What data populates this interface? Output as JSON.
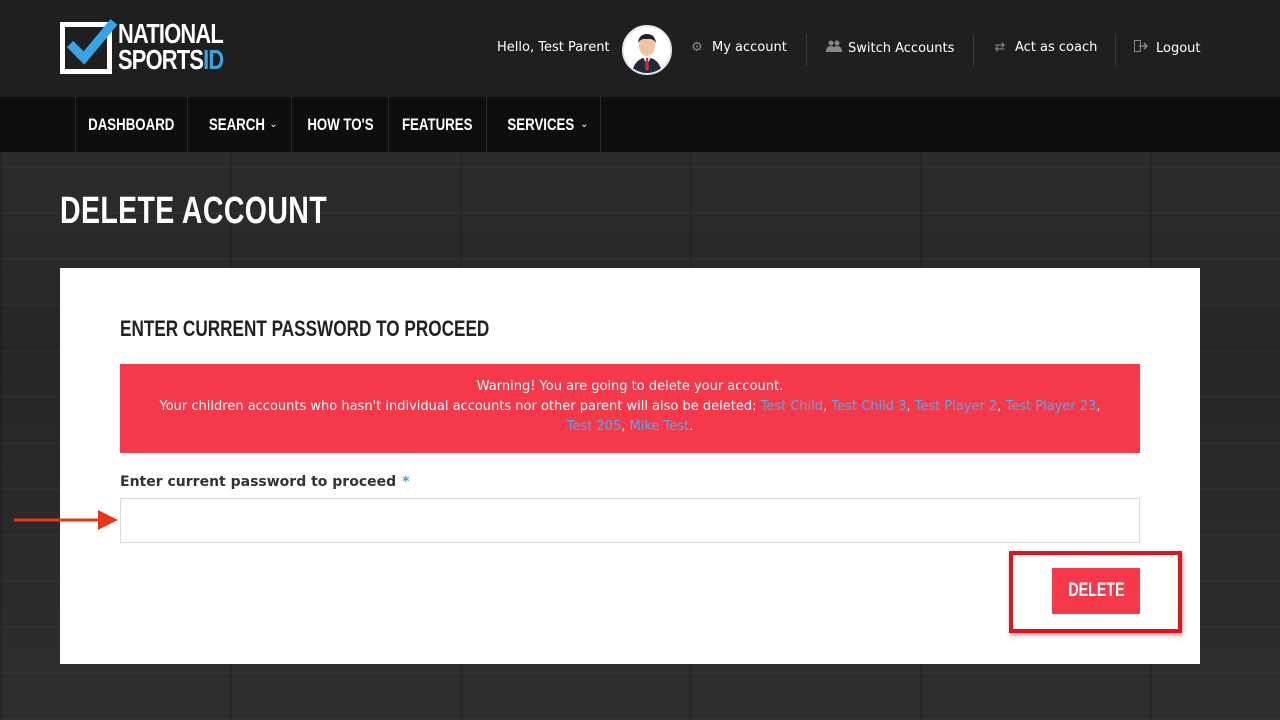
{
  "brand": {
    "line1": "NATIONAL",
    "line2": "SPORTS",
    "suffix": "ID",
    "accent_color": "#3aa3e3"
  },
  "header": {
    "greeting": "Hello, Test Parent",
    "avatar_icon": "user-avatar",
    "links": [
      {
        "label": "My account",
        "icon": "gear-icon"
      },
      {
        "label": "Switch Accounts",
        "icon": "users-icon"
      },
      {
        "label": "Act as coach",
        "icon": "exchange-icon"
      },
      {
        "label": "Logout",
        "icon": "logout-icon"
      }
    ]
  },
  "nav": {
    "items": [
      {
        "label": "DASHBOARD",
        "dropdown": false
      },
      {
        "label": "SEARCH",
        "dropdown": true
      },
      {
        "label": "HOW TO'S",
        "dropdown": false
      },
      {
        "label": "FEATURES",
        "dropdown": false
      },
      {
        "label": "SERVICES",
        "dropdown": true
      }
    ]
  },
  "page": {
    "title": "DELETE ACCOUNT"
  },
  "form": {
    "heading": "ENTER CURRENT PASSWORD TO PROCEED",
    "warning": {
      "line1": "Warning! You are going to delete your account.",
      "line2_prefix": "Your children accounts who hasn't individual accounts nor other parent will also be deleted: ",
      "children": [
        "Test Child",
        "Test Child 3",
        "Test Player 2",
        "Test Player 23",
        "Test 205",
        "Mike Test"
      ],
      "separator": ", ",
      "suffix": ".",
      "background": "#f5384a"
    },
    "password_label": "Enter current password to proceed",
    "required_mark": "*",
    "password_value": "",
    "delete_label": "DELETE"
  }
}
